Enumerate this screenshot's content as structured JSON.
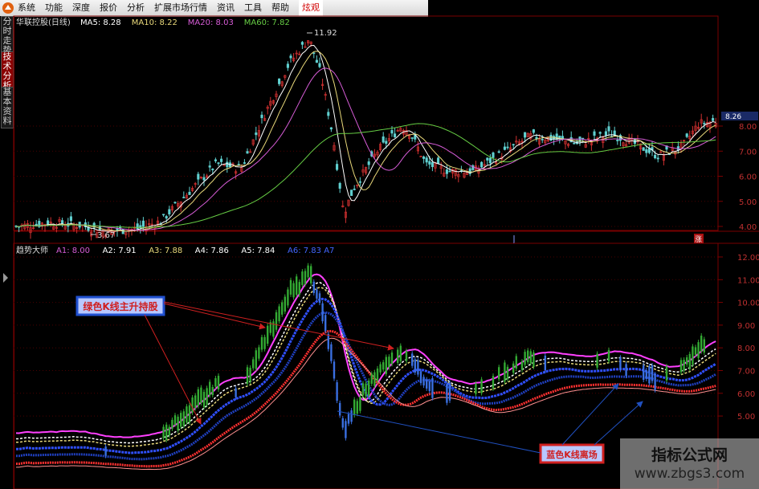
{
  "menu": [
    "系统",
    "功能",
    "深度",
    "报价",
    "分析",
    "扩展市场行情",
    "资讯",
    "工具",
    "帮助",
    "炫观"
  ],
  "menu_selected": 9,
  "side_tabs": [
    {
      "label": "分时走势",
      "active": false
    },
    {
      "label": "技术分析",
      "active": true
    },
    {
      "label": "基本资料",
      "active": false
    }
  ],
  "upper": {
    "title": "华联控股(日线)",
    "legend": [
      {
        "text": "MA5: 8.28",
        "color": "#ffffff"
      },
      {
        "text": "MA10: 8.22",
        "color": "#e8d87a"
      },
      {
        "text": "MA20: 8.03",
        "color": "#d65cd6"
      },
      {
        "text": "MA60: 7.82",
        "color": "#66cc44"
      }
    ],
    "high_label": "11.92",
    "low_label": "3.67",
    "axis_ticks": [
      "8.00",
      "7.00",
      "6.00",
      "5.00",
      "4.00"
    ],
    "price_box": "8.26",
    "marker": "涨"
  },
  "lower": {
    "title": "趋势大师",
    "legend": [
      {
        "text": "A1: 8.00",
        "color": "#d65cd6"
      },
      {
        "text": "A2: 7.91",
        "color": "#ffffff"
      },
      {
        "text": "A3: 7.88",
        "color": "#e8d87a"
      },
      {
        "text": "A4: 7.86",
        "color": "#ffffff"
      },
      {
        "text": "A5: 7.84",
        "color": "#ffffff"
      },
      {
        "text": "A6: 7.83 A7",
        "color": "#4466ff"
      }
    ],
    "axis_ticks": [
      "12.00",
      "11.00",
      "10.00",
      "9.00",
      "8.00",
      "7.00",
      "6.00",
      "5.00"
    ]
  },
  "annotations": {
    "green_text": "绿色K线主升持股",
    "blue_text": "蓝色K线离场"
  },
  "watermark": {
    "line1": "指标公式网",
    "line2": "www.zbgs3.com"
  },
  "colors": {
    "up": "#d03030",
    "down": "#60d0d0",
    "green_k": "#33aa33",
    "blue_k": "#3a6fe0",
    "grid": "#7a0000",
    "axis_text": "#c03030"
  }
}
